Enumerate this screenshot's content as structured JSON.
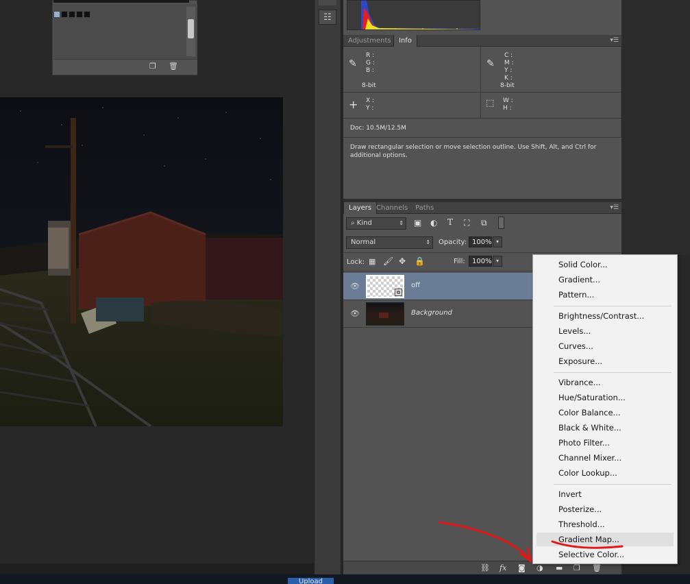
{
  "info_panel": {
    "tabs": [
      "Adjustments",
      "Info"
    ],
    "active_tab": "Info",
    "rgb_labels": [
      "R :",
      "G :",
      "B :"
    ],
    "cmyk_labels": [
      "C :",
      "M :",
      "Y :",
      "K :"
    ],
    "bitdepth_left": "8-bit",
    "bitdepth_right": "8-bit",
    "xy_labels": [
      "X :",
      "Y :"
    ],
    "wh_labels": [
      "W :",
      "H :"
    ],
    "doc_size": "Doc: 10.5M/12.5M",
    "hint_text": "Draw rectangular selection or move selection outline.  Use Shift, Alt, and Ctrl for additional options."
  },
  "layers_panel": {
    "tabs": [
      "Layers",
      "Channels",
      "Paths"
    ],
    "active_tab": "Layers",
    "filter_kind": "Kind",
    "blend_mode": "Normal",
    "opacity_label": "Opacity:",
    "opacity_value": "100%",
    "lock_label": "Lock:",
    "fill_label": "Fill:",
    "fill_value": "100%",
    "layers": [
      {
        "name": "off",
        "selected": true
      },
      {
        "name": "Background",
        "selected": false
      }
    ]
  },
  "adjustment_menu": {
    "groups": [
      [
        "Solid Color...",
        "Gradient...",
        "Pattern..."
      ],
      [
        "Brightness/Contrast...",
        "Levels...",
        "Curves...",
        "Exposure..."
      ],
      [
        "Vibrance...",
        "Hue/Saturation...",
        "Color Balance...",
        "Black & White...",
        "Photo Filter...",
        "Channel Mixer...",
        "Color Lookup..."
      ],
      [
        "Invert",
        "Posterize...",
        "Threshold...",
        "Gradient Map...",
        "Selective Color..."
      ]
    ],
    "highlighted": "Gradient Map..."
  },
  "taskbar": {
    "upload_label": "Upload"
  },
  "colors": {
    "panel_bg": "#535353",
    "selected_layer": "#6b7d96",
    "annotation_red": "#e01818",
    "menu_bg": "#f2f2f2"
  }
}
